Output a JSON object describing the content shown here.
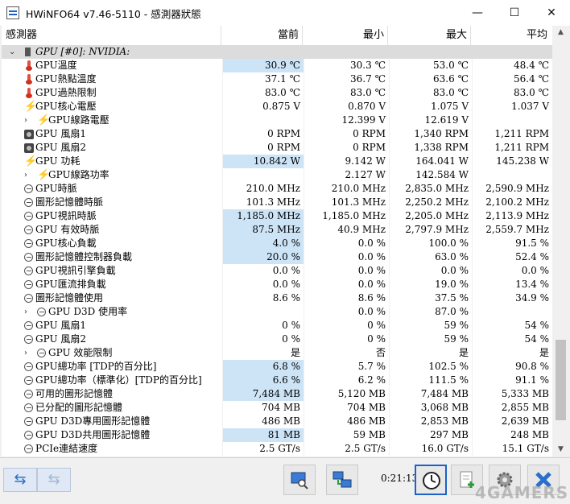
{
  "window": {
    "title": "HWiNFO64 v7.46-5110 - 感測器狀態",
    "min_glyph": "—",
    "max_glyph": "☐",
    "close_glyph": "✕"
  },
  "columns": [
    "感測器",
    "當前",
    "最小",
    "最大",
    "平均"
  ],
  "group": {
    "label": "GPU [#0]: NVIDIA:",
    "icon": "chip-icon"
  },
  "rows": [
    {
      "label": "GPU溫度",
      "icon": "thermometer-icon",
      "cur": "30.9 ℃",
      "min": "30.3 ℃",
      "max": "53.0 ℃",
      "avg": "48.4 ℃",
      "hl": true
    },
    {
      "label": "GPU熱點溫度",
      "icon": "thermometer-icon",
      "cur": "37.1 ℃",
      "min": "36.7 ℃",
      "max": "63.6 ℃",
      "avg": "56.4 ℃"
    },
    {
      "label": "GPU過熱限制",
      "icon": "thermometer-icon",
      "cur": "83.0 ℃",
      "min": "83.0 ℃",
      "max": "83.0 ℃",
      "avg": "83.0 ℃"
    },
    {
      "label": "GPU核心電壓",
      "icon": "bolt-icon",
      "cur": "0.875 V",
      "min": "0.870 V",
      "max": "1.075 V",
      "avg": "1.037 V"
    },
    {
      "label": "GPU線路電壓",
      "icon": "bolt-icon",
      "expand": true,
      "cur": "",
      "min": "12.399 V",
      "max": "12.619 V",
      "avg": ""
    },
    {
      "label": "GPU 風扇1",
      "icon": "fan-icon",
      "cur": "0 RPM",
      "min": "0 RPM",
      "max": "1,340 RPM",
      "avg": "1,211 RPM"
    },
    {
      "label": "GPU 風扇2",
      "icon": "fan-icon",
      "cur": "0 RPM",
      "min": "0 RPM",
      "max": "1,338 RPM",
      "avg": "1,211 RPM"
    },
    {
      "label": "GPU 功耗",
      "icon": "bolt-icon",
      "cur": "10.842 W",
      "min": "9.142 W",
      "max": "164.041 W",
      "avg": "145.238 W",
      "hl": true
    },
    {
      "label": "GPU線路功率",
      "icon": "bolt-icon",
      "expand": true,
      "cur": "",
      "min": "2.127 W",
      "max": "142.584 W",
      "avg": ""
    },
    {
      "label": "GPU時脈",
      "icon": "clock-icon",
      "cur": "210.0 MHz",
      "min": "210.0 MHz",
      "max": "2,835.0 MHz",
      "avg": "2,590.9 MHz"
    },
    {
      "label": "圖形記憶體時脈",
      "icon": "clock-icon",
      "cur": "101.3 MHz",
      "min": "101.3 MHz",
      "max": "2,250.2 MHz",
      "avg": "2,100.2 MHz"
    },
    {
      "label": "GPU視訊時脈",
      "icon": "clock-icon",
      "cur": "1,185.0 MHz",
      "min": "1,185.0 MHz",
      "max": "2,205.0 MHz",
      "avg": "2,113.9 MHz",
      "hl": true
    },
    {
      "label": "GPU 有效時脈",
      "icon": "clock-icon",
      "cur": "87.5 MHz",
      "min": "40.9 MHz",
      "max": "2,797.9 MHz",
      "avg": "2,559.7 MHz",
      "hl": true
    },
    {
      "label": "GPU核心負載",
      "icon": "clock-icon",
      "cur": "4.0 %",
      "min": "0.0 %",
      "max": "100.0 %",
      "avg": "91.5 %",
      "hl": true
    },
    {
      "label": "圖形記憶體控制器負載",
      "icon": "clock-icon",
      "cur": "20.0 %",
      "min": "0.0 %",
      "max": "63.0 %",
      "avg": "52.4 %",
      "hl": true
    },
    {
      "label": "GPU視訊引擎負載",
      "icon": "clock-icon",
      "cur": "0.0 %",
      "min": "0.0 %",
      "max": "0.0 %",
      "avg": "0.0 %"
    },
    {
      "label": "GPU匯流排負載",
      "icon": "clock-icon",
      "cur": "0.0 %",
      "min": "0.0 %",
      "max": "19.0 %",
      "avg": "13.4 %"
    },
    {
      "label": "圖形記憶體使用",
      "icon": "clock-icon",
      "cur": "8.6 %",
      "min": "8.6 %",
      "max": "37.5 %",
      "avg": "34.9 %"
    },
    {
      "label": "GPU D3D 使用率",
      "icon": "clock-icon",
      "expand": true,
      "cur": "",
      "min": "0.0 %",
      "max": "87.0 %",
      "avg": ""
    },
    {
      "label": "GPU 風扇1",
      "icon": "clock-icon",
      "cur": "0 %",
      "min": "0 %",
      "max": "59 %",
      "avg": "54 %"
    },
    {
      "label": "GPU 風扇2",
      "icon": "clock-icon",
      "cur": "0 %",
      "min": "0 %",
      "max": "59 %",
      "avg": "54 %"
    },
    {
      "label": "GPU 效能限制",
      "icon": "clock-icon",
      "expand": true,
      "cur": "是",
      "min": "否",
      "max": "是",
      "avg": "是"
    },
    {
      "label": "GPU總功率 [TDP的百分比]",
      "icon": "clock-icon",
      "cur": "6.8 %",
      "min": "5.7 %",
      "max": "102.5 %",
      "avg": "90.8 %",
      "hl": true
    },
    {
      "label": "GPU總功率（標準化）[TDP的百分比]",
      "icon": "clock-icon",
      "cur": "6.6 %",
      "min": "6.2 %",
      "max": "111.5 %",
      "avg": "91.1 %",
      "hl": true
    },
    {
      "label": "可用的圖形記憶體",
      "icon": "clock-icon",
      "cur": "7,484 MB",
      "min": "5,120 MB",
      "max": "7,484 MB",
      "avg": "5,333 MB",
      "hl": true
    },
    {
      "label": "已分配的圖形記憶體",
      "icon": "clock-icon",
      "cur": "704 MB",
      "min": "704 MB",
      "max": "3,068 MB",
      "avg": "2,855 MB"
    },
    {
      "label": "GPU D3D專用圖形記憶體",
      "icon": "clock-icon",
      "cur": "486 MB",
      "min": "486 MB",
      "max": "2,853 MB",
      "avg": "2,639 MB"
    },
    {
      "label": "GPU D3D共用圖形記憶體",
      "icon": "clock-icon",
      "cur": "81 MB",
      "min": "59 MB",
      "max": "297 MB",
      "avg": "248 MB",
      "hl": true
    },
    {
      "label": "PCIe連結速度",
      "icon": "clock-icon",
      "cur": "2.5 GT/s",
      "min": "2.5 GT/s",
      "max": "16.0 GT/s",
      "avg": "15.1 GT/s"
    }
  ],
  "toolbar": {
    "nav_left_glyph": "⇆",
    "nav_right_glyph": "⇆",
    "elapsed": "0:21:13"
  },
  "watermark": "4GAMERS"
}
